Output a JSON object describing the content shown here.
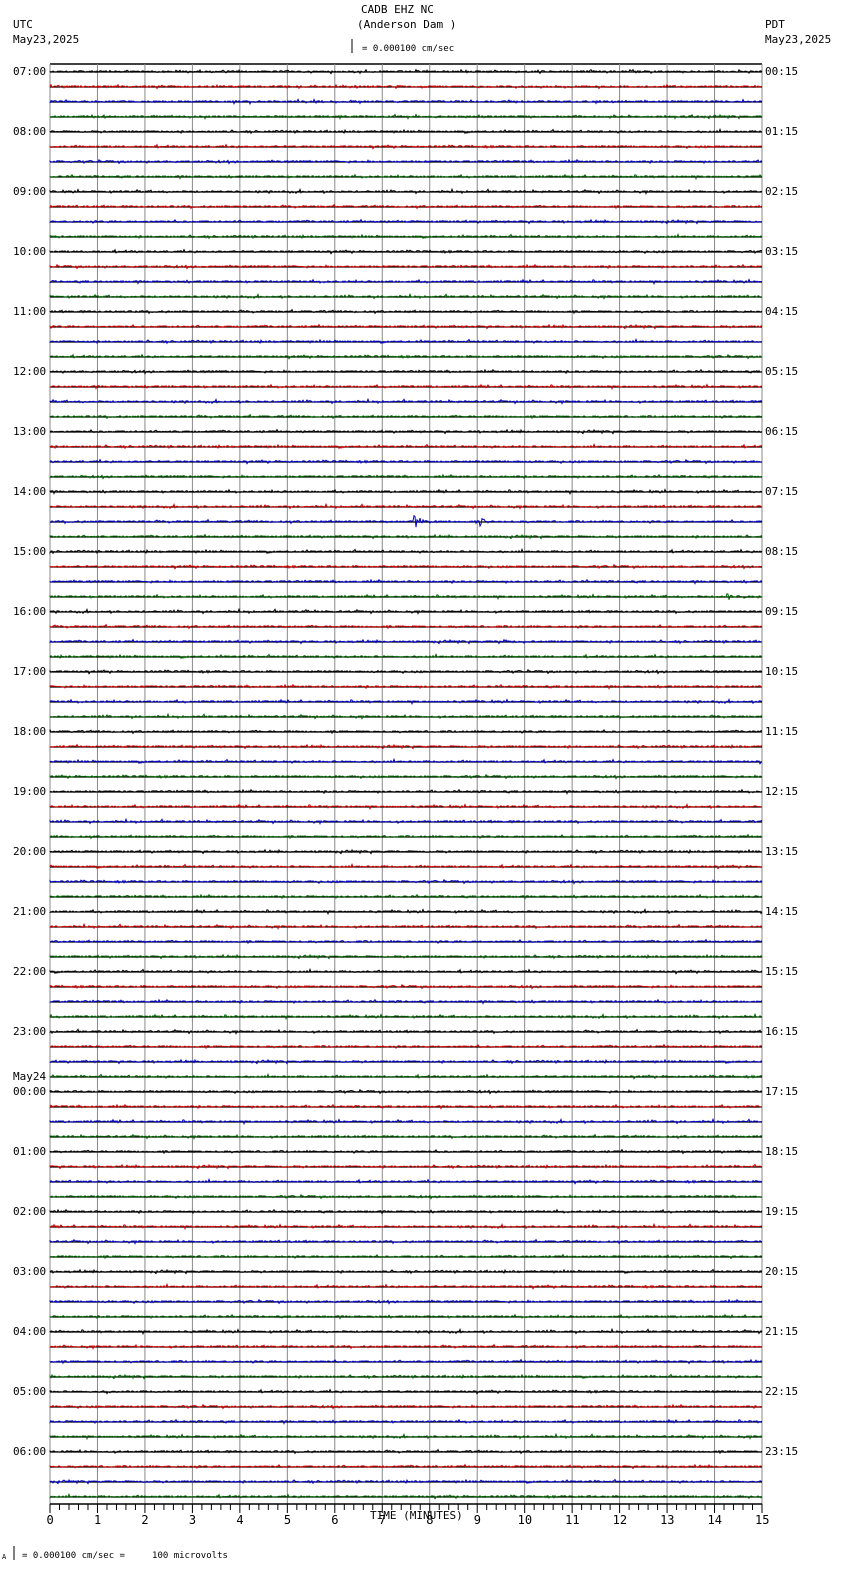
{
  "header": {
    "station": "CADB EHZ NC",
    "location": "(Anderson Dam )",
    "scale": "= 0.000100 cm/sec",
    "left_tz": "UTC",
    "left_date": "May23,2025",
    "right_tz": "PDT",
    "right_date": "May23,2025"
  },
  "footer": {
    "scale_note": "= 0.000100 cm/sec =     100 microvolts",
    "mark": "A"
  },
  "chart_data": {
    "type": "line",
    "title": "CADB EHZ NC (Anderson Dam )",
    "xlabel": "TIME (MINUTES)",
    "xlim": [
      0,
      15
    ],
    "xticks": [
      "0",
      "1",
      "2",
      "3",
      "4",
      "5",
      "6",
      "7",
      "8",
      "9",
      "10",
      "11",
      "12",
      "13",
      "14",
      "15"
    ],
    "traces_per_hour": 4,
    "trace_colors": [
      "#000000",
      "#d00000",
      "#0000c8",
      "#006400"
    ],
    "left_labels": [
      "07:00",
      "08:00",
      "09:00",
      "10:00",
      "11:00",
      "12:00",
      "13:00",
      "14:00",
      "15:00",
      "16:00",
      "17:00",
      "18:00",
      "19:00",
      "20:00",
      "21:00",
      "22:00",
      "23:00",
      "00:00",
      "01:00",
      "02:00",
      "03:00",
      "04:00",
      "05:00",
      "06:00"
    ],
    "date_change_label": "May24",
    "right_labels": [
      "00:15",
      "01:15",
      "02:15",
      "03:15",
      "04:15",
      "05:15",
      "06:15",
      "07:15",
      "08:15",
      "09:15",
      "10:15",
      "11:15",
      "12:15",
      "13:15",
      "14:15",
      "15:15",
      "16:15",
      "17:15",
      "18:15",
      "19:15",
      "20:15",
      "21:15",
      "22:15",
      "23:15"
    ],
    "events": [
      {
        "trace": 2,
        "minute": 5.6,
        "amplitude": 2
      },
      {
        "trace": 30,
        "minute": 7.7,
        "amplitude": 6
      },
      {
        "trace": 30,
        "minute": 9.1,
        "amplitude": 4
      },
      {
        "trace": 35,
        "minute": 14.3,
        "amplitude": 3
      },
      {
        "trace": 36,
        "minute": 5.4,
        "amplitude": 2
      },
      {
        "trace": 38,
        "minute": 9.5,
        "amplitude": 2
      },
      {
        "trace": 72,
        "minute": 13.3,
        "amplitude": 2
      },
      {
        "trace": 88,
        "minute": 1.2,
        "amplitude": 2
      }
    ]
  }
}
